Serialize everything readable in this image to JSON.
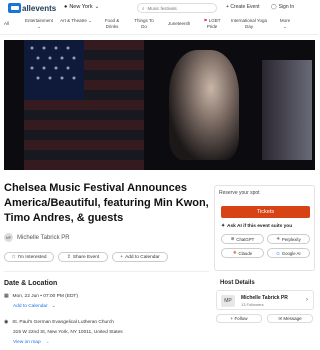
{
  "header": {
    "logo_badge": "",
    "logo_text": "allevents",
    "city": "New York",
    "search_placeholder": "Music festivals",
    "create_event": "Create Event",
    "sign_in": "Sign In"
  },
  "nav": {
    "items": [
      "All",
      "Entertainment",
      "Art & Theatre",
      "Food & Drinks",
      "Things To Do",
      "Juneteenth",
      "LGBT Pride",
      "International Yoga Day",
      "More"
    ]
  },
  "event": {
    "title": "Chelsea Music Festival Announces America/Beautiful, featuring Min Kwon, Timo Andres, & guests",
    "organizer_initials": "MP",
    "organizer": "Michelle Tabrick PR",
    "interested": "I'm Interested",
    "share": "Share Event",
    "add_calendar": "Add to Calendar"
  },
  "date_location": {
    "heading": "Date & Location",
    "date": "Mon, 22 Jun • 07:00 PM (EDT)",
    "add_to_calendar": "Add to Calendar",
    "venue": "St. Paul's German Evangelical Lutheran Church",
    "address": "315 W 22nd St, New York, NY 10011, United States",
    "view_map": "View on map"
  },
  "reserve": {
    "label": "Reserve your spot",
    "tickets": "Tickets",
    "ai_heading": "Ask AI if this event suits you",
    "ai": [
      "ChatGPT",
      "Perplexity",
      "Claude",
      "Google AI"
    ]
  },
  "host": {
    "heading": "Host Details",
    "logo": "MP",
    "name": "Michelle Tabrick PR",
    "followers": "13 Followers",
    "follow": "Follow",
    "message": "Message"
  },
  "colors": {
    "accent": "#d84315",
    "link": "#1a73e8",
    "brand": "#1976d2"
  }
}
